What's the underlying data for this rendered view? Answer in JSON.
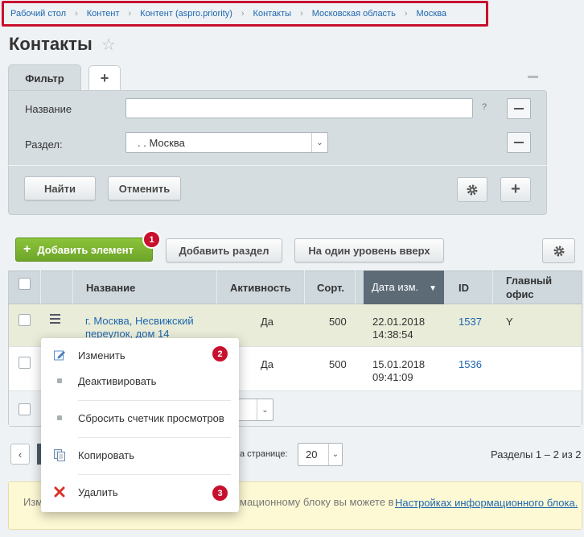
{
  "breadcrumb": [
    "Рабочий стол",
    "Контент",
    "Контент (aspro.priority)",
    "Контакты",
    "Московская область",
    "Москва"
  ],
  "page_title": "Контакты",
  "filter": {
    "tab_label": "Фильтр",
    "tab_add": "+",
    "name_label": "Название",
    "name_value": "",
    "help": "?",
    "section_label": "Раздел:",
    "section_value": ". . Москва",
    "find_button": "Найти",
    "cancel_button": "Отменить"
  },
  "toolbar": {
    "add_element": "Добавить элемент",
    "add_section": "Добавить раздел",
    "level_up": "На один уровень вверх"
  },
  "badges": [
    "1",
    "2",
    "3"
  ],
  "table": {
    "headers": {
      "name": "Название",
      "active": "Активность",
      "sort": "Сорт.",
      "date": "Дата изм.",
      "id": "ID",
      "main_office": "Главный офис"
    },
    "rows": [
      {
        "name": "г. Москва, Несвижский переулок, дом 14",
        "active": "Да",
        "sort": "500",
        "date": "22.01.2018",
        "time": "14:38:54",
        "id": "1537",
        "main_office": "Y"
      },
      {
        "name": "",
        "active": "Да",
        "sort": "500",
        "date": "15.01.2018",
        "time": "09:41:09",
        "id": "1536",
        "main_office": ""
      }
    ]
  },
  "context_menu": [
    "Изменить",
    "Деактивировать",
    "Сбросить счетчик просмотров",
    "Копировать",
    "Удалить"
  ],
  "pager": {
    "per_page_label": "а странице:",
    "per_page_value": "20",
    "summary": "Разделы 1 – 2 из 2"
  },
  "note": {
    "text_start": "Изм",
    "text_mid": "мационному блоку вы можете в",
    "link": "Настройках информационного блока."
  },
  "colors": {
    "accent": "#c8102e",
    "green": "#7ab32f",
    "link": "#2067b0"
  }
}
